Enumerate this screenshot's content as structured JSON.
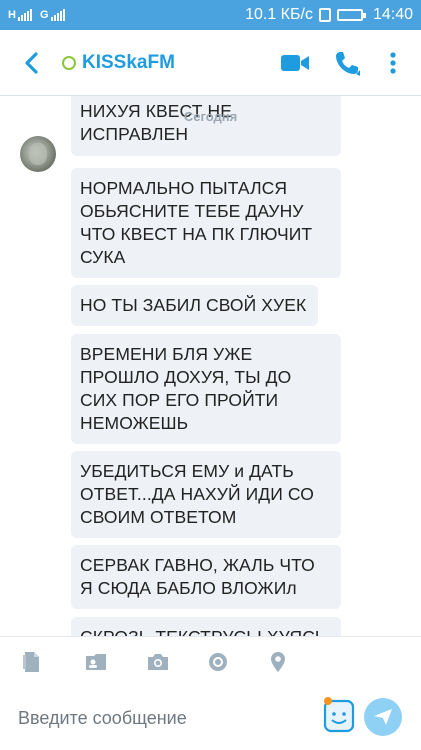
{
  "status_bar": {
    "left_a": "H",
    "left_b": "G",
    "network_speed": "10.1 КБ/с",
    "time": "14:40"
  },
  "header": {
    "contact_name": "KISSkaFM"
  },
  "chat": {
    "date_separator": "Сегодня",
    "messages": [
      "НИХУЯ КВЕСТ НЕ ИСПРАВЛЕН",
      "НОРМАЛЬНО ПЫТАЛСЯ ОБЬЯСНИТЕ ТЕБЕ ДАУНУ ЧТО КВЕСТ НА ПК ГЛЮЧИТ СУКА",
      "НО ТЫ ЗАБИЛ СВОЙ ХУЕК",
      "ВРЕМЕНИ БЛЯ УЖЕ ПРОШЛО ДОХУЯ, ТЫ ДО СИХ ПОР ЕГО ПРОЙТИ НЕМОЖЕШЬ",
      "УБЕДИТЬСЯ ЕМУ и ДАТЬ ОТВЕТ...ДА НАХУЙ ИДИ СО СВОИМ ОТВЕТОМ",
      "СЕРВАК ГАВНО, ЖАЛЬ ЧТО Я СЮДА БАБЛО ВЛОЖИл",
      "СКРОЗЬ ТЕКСТРУСЫ ХУЯСЬ"
    ]
  },
  "compose": {
    "placeholder": "Введите сообщение"
  },
  "icons": {
    "back": "chevron-left-icon",
    "video": "video-call-icon",
    "call": "phone-icon",
    "menu": "more-vertical-icon",
    "file": "file-icon",
    "contact_card": "contact-card-icon",
    "camera": "camera-icon",
    "media": "media-icon",
    "location": "location-pin-icon",
    "emoji": "emoticon-icon",
    "send": "send-icon"
  },
  "colors": {
    "brand": "#1f9be0",
    "status_bar": "#4aa3df",
    "bubble": "#eef1f5",
    "icon_grey": "#9fb1bf",
    "presence": "#8cc63f",
    "send_button": "#8fd0f5"
  }
}
